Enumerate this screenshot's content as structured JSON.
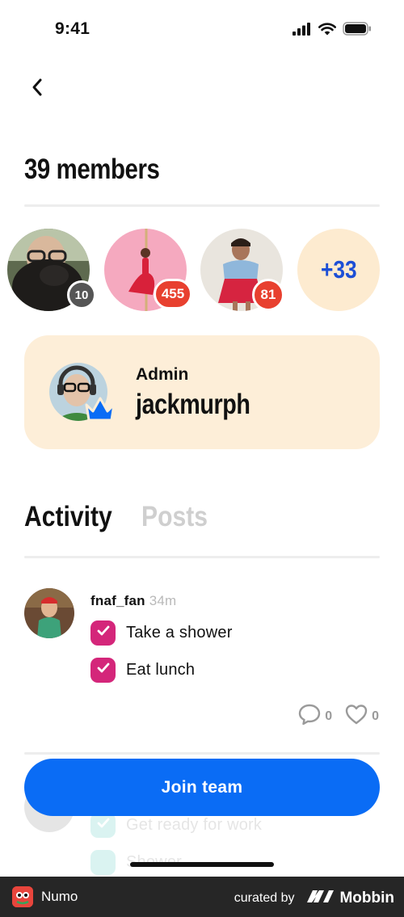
{
  "status_bar": {
    "time": "9:41"
  },
  "header": {
    "title": "39 members"
  },
  "members": {
    "avatars": [
      {
        "badge": "10",
        "badge_color": "#555555"
      },
      {
        "badge": "455",
        "badge_color": "#e8402f"
      },
      {
        "badge": "81",
        "badge_color": "#e8402f"
      }
    ],
    "more_count": "+33"
  },
  "admin": {
    "label": "Admin",
    "username": "jackmurph"
  },
  "tabs": [
    {
      "label": "Activity",
      "active": true
    },
    {
      "label": "Posts",
      "active": false
    }
  ],
  "activity": {
    "post": {
      "username": "fnaf_fan",
      "time": "34m",
      "tasks": [
        "Take a shower",
        "Eat lunch"
      ],
      "comments": "0",
      "likes": "0"
    },
    "faded_post": {
      "tasks": [
        "Get ready for work",
        "Shower"
      ]
    }
  },
  "join_button": {
    "label": "Join team"
  },
  "footer": {
    "app_name": "Numo",
    "curated_by": "curated by",
    "brand": "Mobbin"
  },
  "colors": {
    "accent_blue": "#0a6cf5",
    "check_pink": "#d4267a",
    "card_peach": "#fdeed8",
    "badge_red": "#e8402f"
  }
}
